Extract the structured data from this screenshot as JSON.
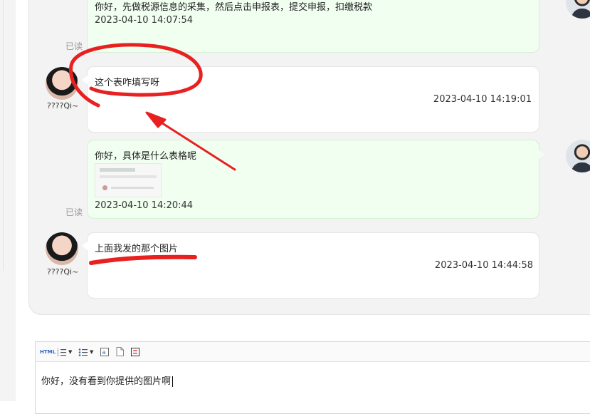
{
  "messages": [
    {
      "direction": "out",
      "text": "你好，先做税源信息的采集，然后点击申报表，提交申报，扣缴税款",
      "time": "2023-04-10 14:07:54",
      "read": "已读"
    },
    {
      "direction": "in",
      "sender": "????Qi~",
      "text": "这个表咋填写呀",
      "time": "2023-04-10 14:19:01"
    },
    {
      "direction": "out",
      "text": "你好，具体是什么表格呢",
      "time": "2023-04-10 14:20:44",
      "read": "已读",
      "has_image": true
    },
    {
      "direction": "in",
      "sender": "????Qi~",
      "text": "上面我发的那个图片",
      "time": "2023-04-10 14:44:58"
    }
  ],
  "editor": {
    "toolbar": {
      "html_label": "HTML",
      "items": [
        "html-icon",
        "ordered-list-icon",
        "unordered-list-icon",
        "text-format-icon",
        "document-icon",
        "form-icon"
      ]
    },
    "content": "你好，没有看到你提供的图片啊"
  },
  "annotation_color": "#e82020"
}
